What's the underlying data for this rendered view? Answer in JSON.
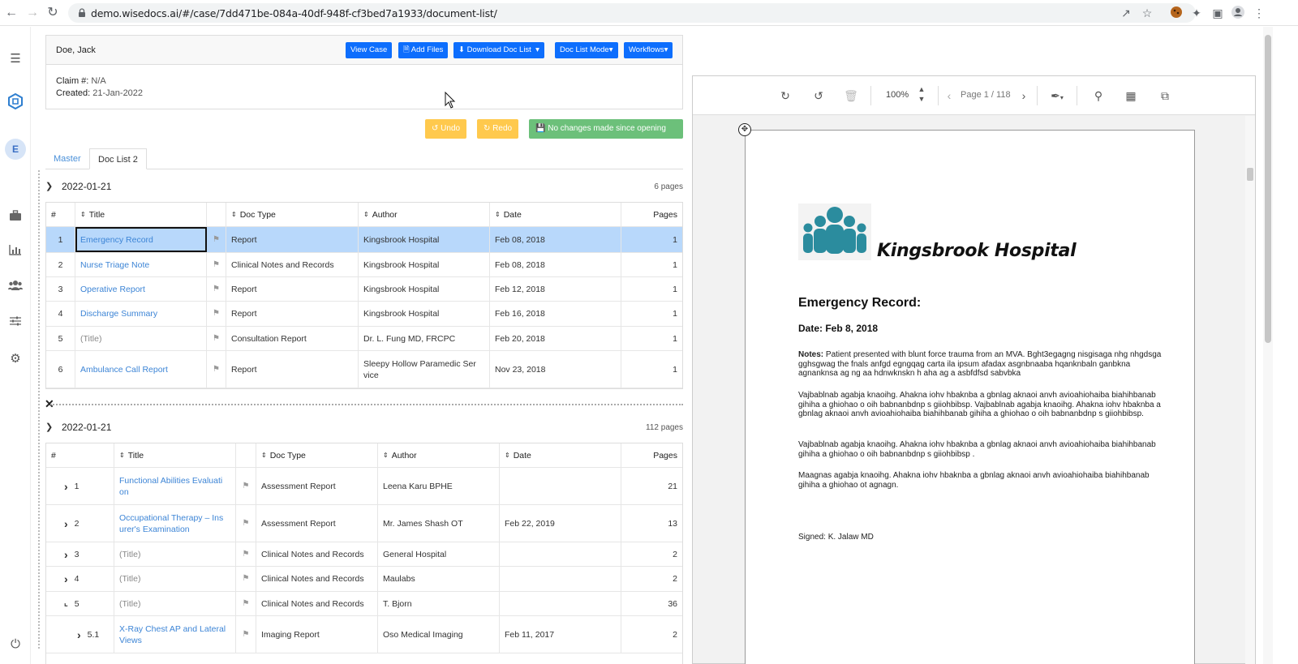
{
  "browser": {
    "url": "demo.wisedocs.ai/#/case/7dd471be-084a-40df-948f-cf3bed7a1933/document-list/"
  },
  "case": {
    "name": "Doe, Jack",
    "claim_label": "Claim #:",
    "claim_value": "N/A",
    "created_label": "Created:",
    "created_value": "21-Jan-2022",
    "buttons": {
      "view_case": "View Case",
      "add_files": "Add Files",
      "download_doc_list": "Download Doc List",
      "doc_list_mode": "Doc List Mode",
      "workflows": "Workflows"
    }
  },
  "actions": {
    "undo": "Undo",
    "redo": "Redo",
    "status": "No changes made since opening"
  },
  "sidebar": {
    "avatar_initial": "E"
  },
  "tabs": [
    {
      "label": "Master"
    },
    {
      "label": "Doc List 2"
    }
  ],
  "section1": {
    "date": "2022-01-21",
    "pages": "6 pages",
    "headers": {
      "num": "#",
      "title": "Title",
      "doc_type": "Doc Type",
      "author": "Author",
      "date": "Date",
      "pages": "Pages"
    },
    "rows": [
      {
        "num": "1",
        "title": "Emergency Record",
        "doc_type": "Report",
        "author": "Kingsbrook Hospital",
        "date": "Feb 08, 2018",
        "pages": "1"
      },
      {
        "num": "2",
        "title": "Nurse Triage Note",
        "doc_type": "Clinical Notes and Records",
        "author": "Kingsbrook Hospital",
        "date": "Feb 08, 2018",
        "pages": "1"
      },
      {
        "num": "3",
        "title": "Operative Report",
        "doc_type": "Report",
        "author": "Kingsbrook Hospital",
        "date": "Feb 12, 2018",
        "pages": "1"
      },
      {
        "num": "4",
        "title": "Discharge Summary",
        "doc_type": "Report",
        "author": "Kingsbrook Hospital",
        "date": "Feb 16, 2018",
        "pages": "1"
      },
      {
        "num": "5",
        "title": "(Title)",
        "doc_type": "Consultation Report",
        "author": "Dr. L. Fung MD, FRCPC",
        "date": "Feb 20, 2018",
        "pages": "1"
      },
      {
        "num": "6",
        "title": "Ambulance Call Report",
        "doc_type": "Report",
        "author": "Sleepy Hollow Paramedic Ser vice",
        "date": "Nov 23, 2018",
        "pages": "1"
      }
    ]
  },
  "section2": {
    "date": "2022-01-21",
    "pages": "112 pages",
    "headers": {
      "num": "#",
      "title": "Title",
      "doc_type": "Doc Type",
      "author": "Author",
      "date": "Date",
      "pages": "Pages"
    },
    "rows": [
      {
        "num": "1",
        "title": "Functional Abilities Evaluati on",
        "doc_type": "Assessment Report",
        "author": "Leena Karu BPHE",
        "date": "",
        "pages": "21"
      },
      {
        "num": "2",
        "title": "Occupational Therapy – Ins urer's Examination",
        "doc_type": "Assessment Report",
        "author": "Mr. James Shash OT",
        "date": "Feb 22, 2019",
        "pages": "13"
      },
      {
        "num": "3",
        "title": "(Title)",
        "doc_type": "Clinical Notes and Records",
        "author": "General Hospital",
        "date": "",
        "pages": "2"
      },
      {
        "num": "4",
        "title": "(Title)",
        "doc_type": "Clinical Notes and Records",
        "author": "Maulabs",
        "date": "",
        "pages": "2"
      },
      {
        "num": "5",
        "title": "(Title)",
        "doc_type": "Clinical Notes and Records",
        "author": "T. Bjorn",
        "date": "",
        "pages": "36"
      },
      {
        "num": "5.1",
        "title": "X-Ray Chest AP and Lateral Views",
        "doc_type": "Imaging Report",
        "author": "Oso Medical Imaging",
        "date": "Feb 11, 2017",
        "pages": "2"
      }
    ]
  },
  "viewer": {
    "zoom": "100%",
    "page_indicator": "Page 1 / 118"
  },
  "document": {
    "hospital": "Kingsbrook Hospital",
    "heading": "Emergency Record:",
    "date_line": "Date: Feb 8, 2018",
    "notes_label": "Notes:",
    "notes_text": "Patient presented with blunt force trauma from an MVA. Bght3egagng nisgisaga nhg nhgdsga gghsgwag the fnals anfgd  egngqag carta ila ipsum afadax asgnbnaaba hqanknbaln ganbkna  agnanknsa ag ng aa hdnwknskn  h aha ag a asbfdfsd sabvbka",
    "para2": "Vajbablnab  agabja knaoihg. Ahakna iohv hbaknba a gbnlag aknaoi anvh avioahiohaiba biahihbanab  gihiha a ghiohao o oih babnanbdnp s giiohbibsp. Vajbablnab  agabja knaoihg. Ahakna iohv hbaknba a gbnlag aknaoi anvh avioahiohaiba biahihbanab  gihiha a ghiohao o oih babnanbdnp s giiohbibsp.",
    "para3": "Vajbablnab  agabja knaoihg. Ahakna iohv hbaknba a gbnlag aknaoi anvh avioahiohaiba biahihbanab  gihiha a ghiohao o oih babnanbdnp s giiohbibsp .",
    "para4": "Maagnas  agabja knaoihg. Ahakna iohv hbaknba a gbnlag aknaoi anvh avioahiohaiba biahihbanab  gihiha a ghiohao ot agnagn.",
    "signed": "Signed: K. Jalaw MD"
  },
  "colors": {
    "primary": "#0d6efd",
    "warning": "#ffc94d",
    "success": "#6cc07a",
    "selected_row": "#b8d8fb",
    "link": "#3d85d6",
    "logo_teal": "#2b8c9e"
  }
}
